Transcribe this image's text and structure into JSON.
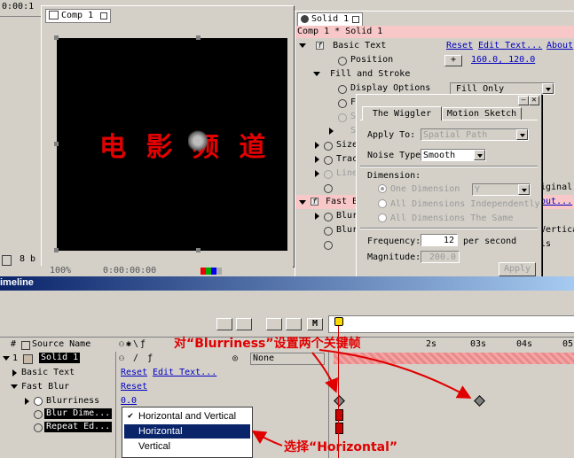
{
  "top_left": {
    "timecode": "0:00:1"
  },
  "comp": {
    "tab_label": "Comp 1",
    "canvas_title": "电 影 频 道",
    "footer_label": "8 b"
  },
  "effects": {
    "tab_label": "Solid 1",
    "header": "Comp 1 * Solid 1",
    "basic_text": {
      "name": "Basic Text",
      "reset": "Reset",
      "edit_text": "Edit Text...",
      "about": "About"
    },
    "position": {
      "label": "Position",
      "value": "160.0, 120.0"
    },
    "fill_stroke": "Fill and Stroke",
    "display_options": {
      "label": "Display Options",
      "value": "Fill Only"
    },
    "partial_labels": [
      "F",
      "S",
      "S",
      "Size",
      "Trac",
      "Line"
    ],
    "fast_blur": "Fast B",
    "blur_rows": [
      "Blur",
      "Blur"
    ],
    "right_partials": [
      "iginal",
      "out...",
      "Vertica",
      "ls"
    ]
  },
  "wiggler": {
    "tabs": [
      "The Wiggler",
      "Motion Sketch"
    ],
    "apply_to": {
      "label": "Apply To:",
      "value": "Spatial Path"
    },
    "noise_type": {
      "label": "Noise Type",
      "value": "Smooth"
    },
    "dimension": {
      "label": "Dimension:",
      "options": [
        "One Dimension",
        "All Dimensions Independently",
        "All Dimensions The Same"
      ],
      "one_dim_value": "Y"
    },
    "frequency": {
      "label": "Frequency:",
      "value": "12",
      "unit": "per second"
    },
    "magnitude": {
      "label": "Magnitude:",
      "value": "200.0"
    },
    "apply_button": "Apply"
  },
  "timeline": {
    "title": "imeline",
    "columns": {
      "num": "#",
      "source": "Source Name",
      "mode": "None"
    },
    "rows": [
      {
        "num": "1",
        "name": "Solid 1"
      },
      {
        "name": "Basic Text",
        "reset": "Reset",
        "edit": "Edit Text..."
      },
      {
        "name": "Fast Blur",
        "reset": "Reset"
      },
      {
        "name": "Blurriness",
        "value": "0.0"
      },
      {
        "name": "Blur Dime..."
      },
      {
        "name": "Repeat Ed..."
      }
    ],
    "ruler": [
      "2s",
      "03s",
      "04s",
      "05"
    ],
    "menu_items": [
      "Horizontal and Vertical",
      "Horizontal",
      "Vertical"
    ],
    "checked_index": 0,
    "selected_index": 1
  },
  "annotations": {
    "top": "对“Blurriness”设置两个关键帧",
    "bottom": "选择“Horizontal”"
  },
  "bottom_strip": {
    "zoom": "100%",
    "time": "0:00:00:00"
  }
}
